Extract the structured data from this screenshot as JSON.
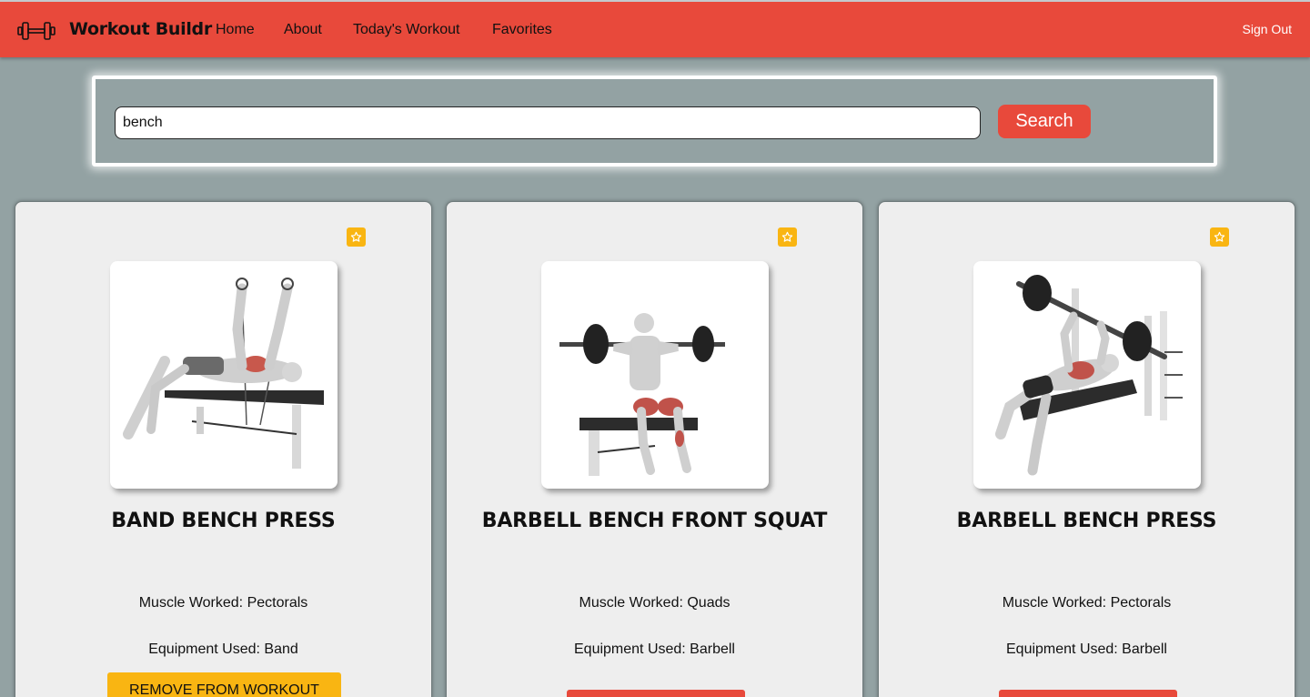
{
  "nav": {
    "brand": "Workout Buildr",
    "links": [
      {
        "label": "Home"
      },
      {
        "label": "About"
      },
      {
        "label": "Today's Workout"
      },
      {
        "label": "Favorites"
      }
    ],
    "sign_out": "Sign Out",
    "brand_icon": "dumbbell-icon"
  },
  "search": {
    "value": "bench",
    "button_label": "Search"
  },
  "cards": [
    {
      "title": "BAND BENCH PRESS",
      "muscle": "Muscle Worked: Pectorals",
      "equipment": "Equipment Used: Band",
      "action_label": "REMOVE FROM WORKOUT",
      "favorite_icon": "star-icon"
    },
    {
      "title": "BARBELL BENCH FRONT SQUAT",
      "muscle": "Muscle Worked: Quads",
      "equipment": "Equipment Used: Barbell",
      "action_label": "",
      "favorite_icon": "star-icon"
    },
    {
      "title": "BARBELL BENCH PRESS",
      "muscle": "Muscle Worked: Pectorals",
      "equipment": "Equipment Used: Barbell",
      "action_label": "",
      "favorite_icon": "star-icon"
    }
  ],
  "colors": {
    "accent": "#e8493b",
    "favorite": "#f9b512",
    "background": "#93a2a3",
    "card": "#eeeeee"
  }
}
